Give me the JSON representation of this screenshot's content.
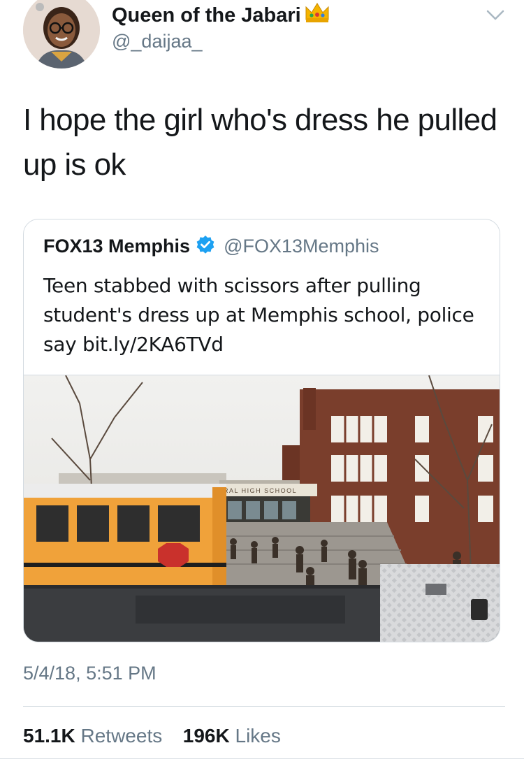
{
  "author": {
    "display_name": "Queen of the Jabari",
    "handle": "@_daijaa_",
    "crown_icon": "crown-emoji",
    "avatar": "profile-photo"
  },
  "tweet": {
    "text": "I hope the girl who's dress he pulled up is ok",
    "timestamp": "5/4/18, 5:51 PM"
  },
  "quoted_tweet": {
    "display_name": "FOX13 Memphis",
    "verified_icon": "verified-badge",
    "handle": "@FOX13Memphis",
    "text": "Teen stabbed with scissors after pulling student's dress up at Memphis school, police say bit.ly/2KA6TVd",
    "image": {
      "description_icon": "photo",
      "school_sign": "RAL HIGH SCHOOL"
    }
  },
  "stats": {
    "retweets_count": "51.1K",
    "retweets_label": "Retweets",
    "likes_count": "196K",
    "likes_label": "Likes"
  },
  "colors": {
    "text": "#14171a",
    "secondary": "#657786",
    "border": "#d4dbe1",
    "verified": "#1da1f2"
  }
}
